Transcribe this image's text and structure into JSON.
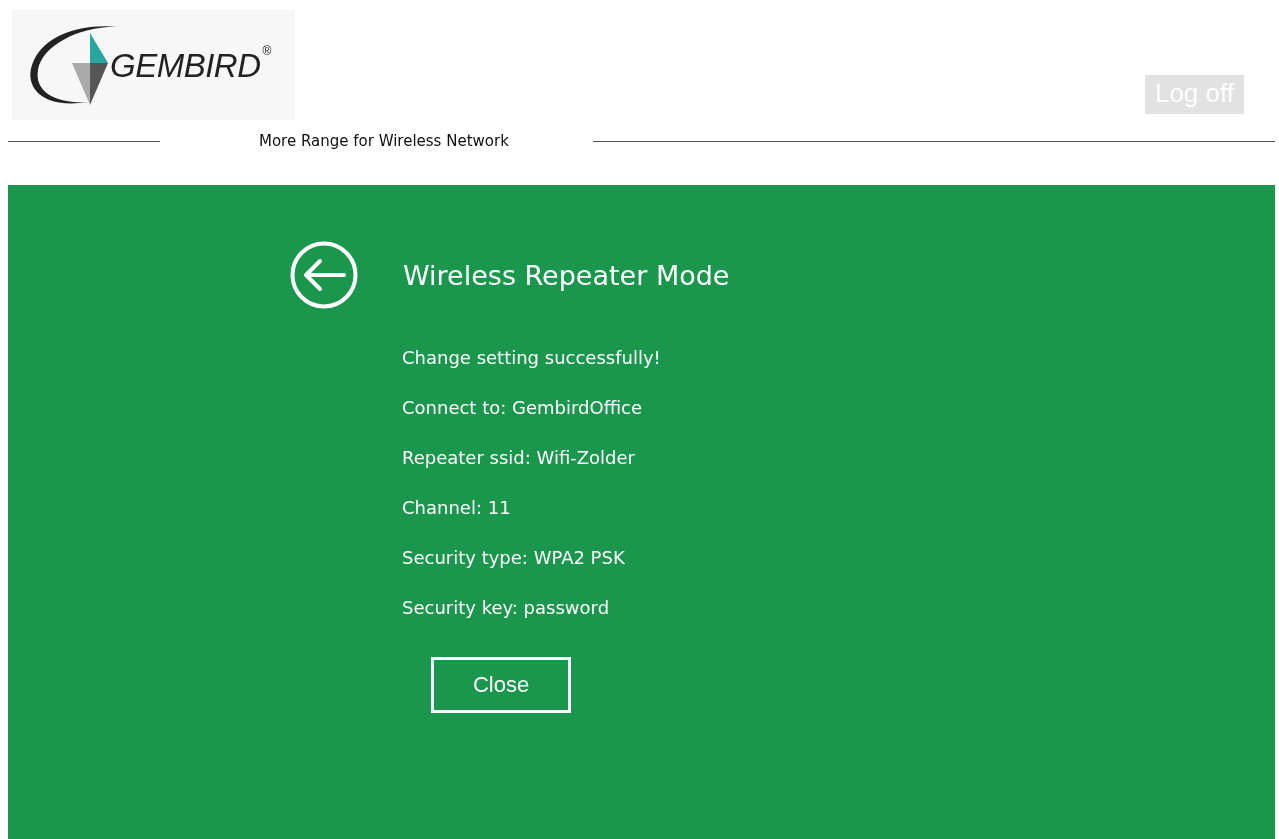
{
  "header": {
    "logo": {
      "text": "GEMBIRD",
      "mark": "®"
    },
    "logoff_button": "Log off",
    "tagline": "More Range for Wireless Network"
  },
  "panel": {
    "title": "Wireless Repeater Mode",
    "lines": [
      "Change setting successfully!",
      "Connect to: GembirdOffice",
      "Repeater ssid: Wifi-Zolder",
      "Channel: 11",
      "Security type: WPA2 PSK",
      "Security key: password"
    ],
    "close_button": "Close"
  }
}
